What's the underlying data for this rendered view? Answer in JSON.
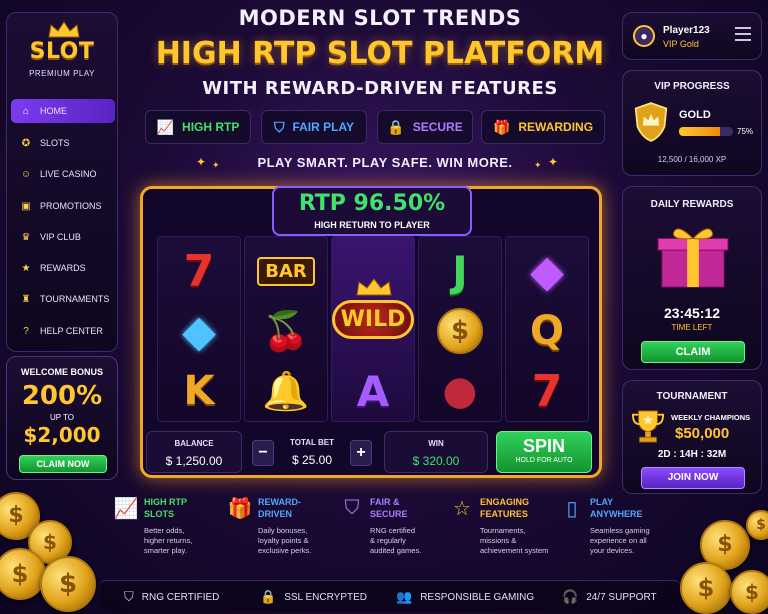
{
  "colors": {
    "gold": "#ffc62e",
    "green": "#43e06a",
    "purple": "#7b3cf0",
    "background": "#1c0a36"
  },
  "logo": {
    "title": "SLOT",
    "subtitle": "PREMIUM PLAY"
  },
  "sidebar": {
    "items": [
      {
        "label": "HOME",
        "icon": "home-icon",
        "active": true
      },
      {
        "label": "SLOTS",
        "icon": "slot-chip-icon",
        "active": false
      },
      {
        "label": "LIVE CASINO",
        "icon": "dealer-icon",
        "active": false
      },
      {
        "label": "PROMOTIONS",
        "icon": "gift-icon",
        "active": false
      },
      {
        "label": "VIP CLUB",
        "icon": "crown-icon",
        "active": false
      },
      {
        "label": "REWARDS",
        "icon": "star-icon",
        "active": false
      },
      {
        "label": "TOURNAMENTS",
        "icon": "trophy-icon",
        "active": false
      },
      {
        "label": "HELP CENTER",
        "icon": "help-icon",
        "active": false
      }
    ]
  },
  "welcome_bonus": {
    "title": "WELCOME BONUS",
    "percent": "200%",
    "up_to": "UP TO",
    "amount": "$2,000",
    "button": "CLAIM NOW"
  },
  "header": {
    "line1": "MODERN SLOT TRENDS",
    "line2": "HIGH RTP SLOT PLATFORM",
    "line3": "WITH REWARD-DRIVEN FEATURES"
  },
  "feature_pills": [
    {
      "label": "HIGH RTP",
      "icon": "chart-up-icon",
      "color": "#43e06a"
    },
    {
      "label": "FAIR PLAY",
      "icon": "shield-icon",
      "color": "#4fa8ff"
    },
    {
      "label": "SECURE",
      "icon": "lock-icon",
      "color": "#b07cff"
    },
    {
      "label": "REWARDING",
      "icon": "gift-icon",
      "color": "#ffc62e"
    }
  ],
  "tagline": "PLAY SMART. PLAY SAFE. WIN MORE.",
  "rtp": {
    "value": "RTP 96.50%",
    "subtitle": "HIGH RETURN TO PLAYER"
  },
  "reels": [
    [
      {
        "text": "7",
        "color": "#e8322e"
      },
      {
        "text": "◆",
        "color": "#4fc3ff"
      },
      {
        "text": "K",
        "color": "#f0a828"
      }
    ],
    [
      {
        "text": "BAR",
        "color": "#ffc62e"
      },
      {
        "text": "🍒",
        "color": "#e02838"
      },
      {
        "text": "🔔",
        "color": "#ffc62e"
      }
    ],
    [
      {
        "text": "WILD",
        "color": "#ffc62e"
      },
      {
        "text": "A",
        "color": "#a45cff"
      }
    ],
    [
      {
        "text": "J",
        "color": "#43d45a"
      },
      {
        "text": "$",
        "color": "#ffc62e"
      },
      {
        "text": "●",
        "color": "#c0283c"
      }
    ],
    [
      {
        "text": "◆",
        "color": "#c05cff"
      },
      {
        "text": "Q",
        "color": "#f0a828"
      },
      {
        "text": "7",
        "color": "#e8322e"
      }
    ]
  ],
  "controls": {
    "balance_label": "BALANCE",
    "balance_value": "$ 1,250.00",
    "minus": "−",
    "plus": "+",
    "bet_label": "TOTAL BET",
    "bet_value": "$ 25.00",
    "win_label": "WIN",
    "win_value": "$ 320.00",
    "spin_label": "SPIN",
    "spin_sub": "HOLD FOR AUTO"
  },
  "profile": {
    "name": "Player123",
    "tier": "VIP Gold"
  },
  "vip_progress": {
    "title": "VIP PROGRESS",
    "level": "GOLD",
    "percent_label": "75%",
    "progress": 0.75,
    "xp": "12,500 / 16,000 XP"
  },
  "daily_rewards": {
    "title": "DAILY REWARDS",
    "timer": "23:45:12",
    "time_left": "TIME LEFT",
    "button": "CLAIM"
  },
  "tournament": {
    "title": "TOURNAMENT",
    "subtitle": "WEEKLY CHAMPIONS",
    "prize": "$50,000",
    "countdown": "2D : 14H : 32M",
    "button": "JOIN NOW"
  },
  "features": [
    {
      "title": "HIGH RTP\nSLOTS",
      "desc": "Better odds,\nhigher returns,\nsmarter play.",
      "color": "#43e06a",
      "icon": "chart-up-icon"
    },
    {
      "title": "REWARD-\nDRIVEN",
      "desc": "Daily bonuses,\nloyalty points &\nexclusive perks.",
      "color": "#4fa8ff",
      "icon": "gift-icon"
    },
    {
      "title": "FAIR &\nSECURE",
      "desc": "RNG certified\n& regularly\naudited games.",
      "color": "#b07cff",
      "icon": "shield-icon"
    },
    {
      "title": "ENGAGING\nFEATURES",
      "desc": "Tournaments,\nmissions &\nachievement system",
      "color": "#ffc62e",
      "icon": "star-icon"
    },
    {
      "title": "PLAY\nANYWHERE",
      "desc": "Seamless gaming\nexperience on all\nyour devices.",
      "color": "#4fa8ff",
      "icon": "mobile-icon"
    }
  ],
  "trust": [
    {
      "label": "RNG CERTIFIED",
      "icon": "shield-check-icon"
    },
    {
      "label": "SSL ENCRYPTED",
      "icon": "lock-icon"
    },
    {
      "label": "RESPONSIBLE GAMING",
      "icon": "people-icon"
    },
    {
      "label": "24/7 SUPPORT",
      "icon": "headset-icon"
    }
  ]
}
